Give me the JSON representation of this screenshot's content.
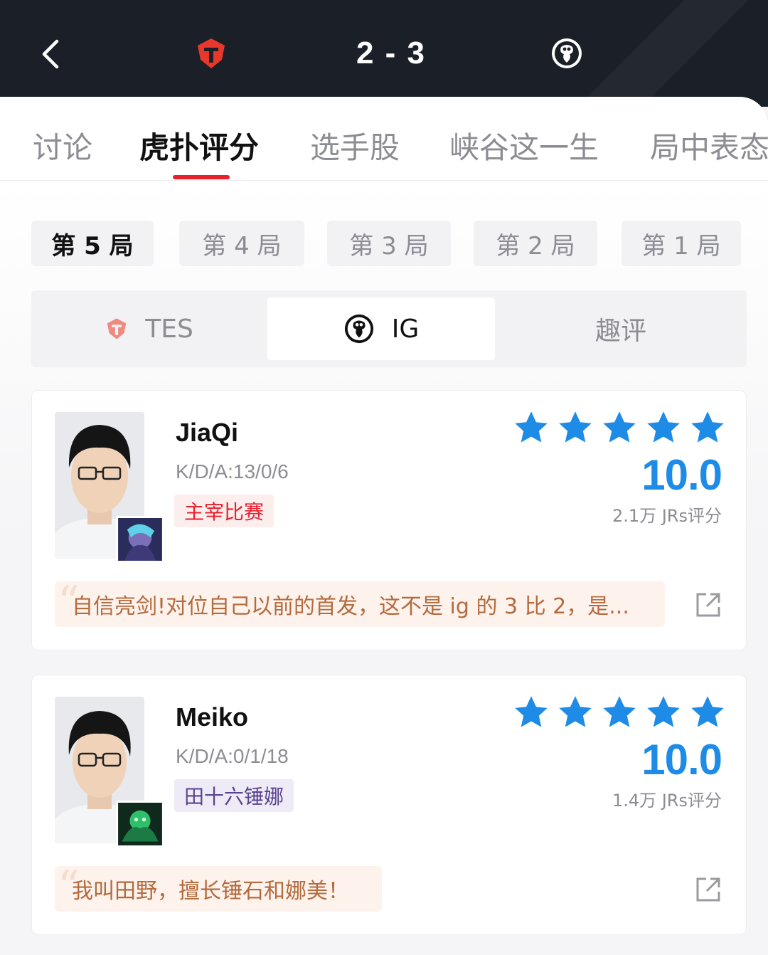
{
  "header": {
    "score": "2 - 3"
  },
  "tabs": [
    {
      "label": "讨论"
    },
    {
      "label": "虎扑评分"
    },
    {
      "label": "选手股"
    },
    {
      "label": "峡谷这一生"
    },
    {
      "label": "局中表态"
    }
  ],
  "games": [
    {
      "label": "第 5 局"
    },
    {
      "label": "第 4 局"
    },
    {
      "label": "第 3 局"
    },
    {
      "label": "第 2 局"
    },
    {
      "label": "第 1 局"
    }
  ],
  "segments": [
    {
      "label": "TES",
      "icon": "tes-logo-icon"
    },
    {
      "label": "IG",
      "icon": "ig-logo-icon"
    },
    {
      "label": "趣评"
    }
  ],
  "players": [
    {
      "name": "JiaQi",
      "kda": "K/D/A:13/0/6",
      "tag": "主宰比赛",
      "rating": 5,
      "score": "10.0",
      "votes": "2.1万 JRs评分",
      "comment": "自信亮剑!对位自己以前的首发，这不是 ig 的 3 比 2，是..."
    },
    {
      "name": "Meiko",
      "kda": "K/D/A:0/1/18",
      "tag": "田十六锤娜",
      "rating": 5,
      "score": "10.0",
      "votes": "1.4万 JRs评分",
      "comment": "我叫田野，擅长锤石和娜美！"
    }
  ],
  "colors": {
    "accent_red": "#e8202e",
    "star_blue": "#1e8ce6",
    "header_bg": "#1b1f27"
  }
}
